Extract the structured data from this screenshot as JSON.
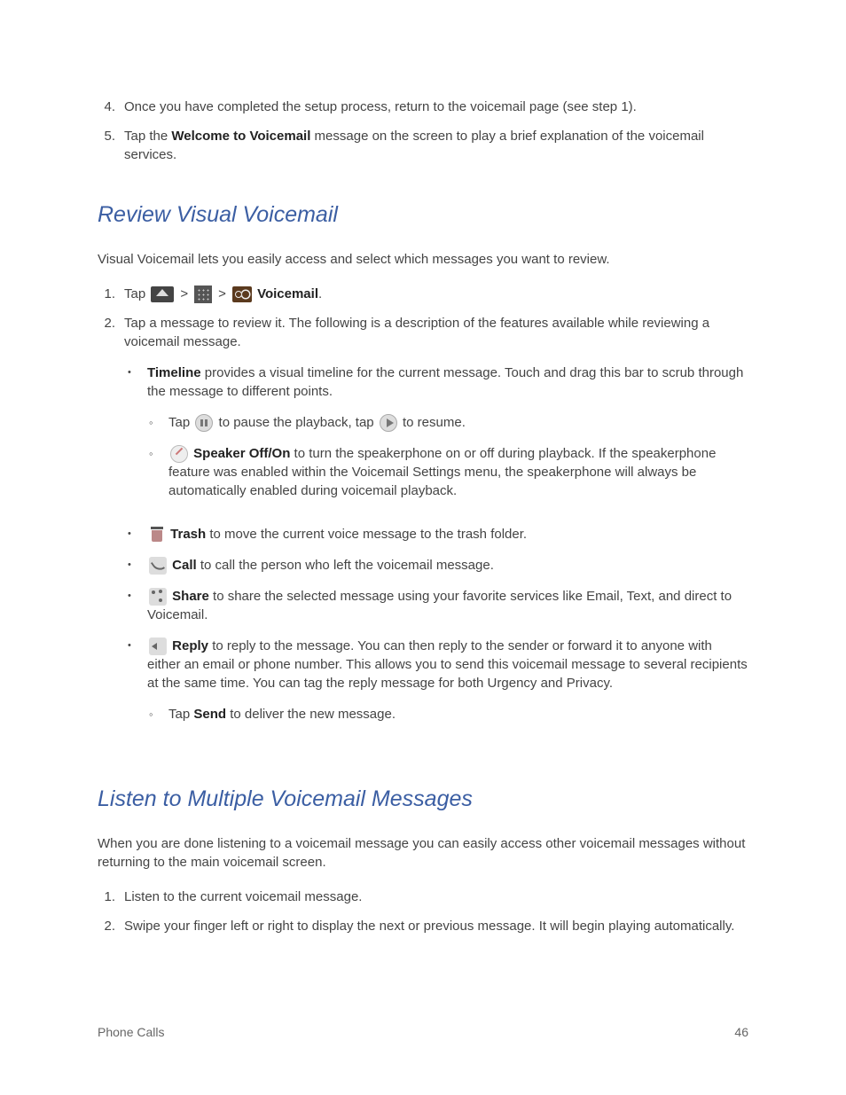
{
  "top_list": {
    "item4": {
      "num": "4.",
      "text": "Once you have completed the setup process, return to the voicemail page (see step 1)."
    },
    "item5": {
      "num": "5.",
      "pre": "Tap the ",
      "bold": "Welcome to Voicemail",
      "post": " message on the screen to play a brief explanation of the voicemail services."
    }
  },
  "section1": {
    "heading": "Review Visual Voicemail",
    "intro": "Visual Voicemail lets you easily access and select which messages you want to review.",
    "step1": {
      "num": "1.",
      "pre": "Tap ",
      "sep": ">",
      "vm_label": "Voicemail",
      "period": "."
    },
    "step2": {
      "num": "2.",
      "text": "Tap a message to review it. The following is a description of the features available while reviewing a voicemail message.",
      "timeline": {
        "bold": "Timeline",
        "text": " provides a visual timeline for the current message. Touch and drag this bar to scrub through the message to different points.",
        "sub1": {
          "pre": "Tap ",
          "mid": " to pause the playback, tap ",
          "post": " to resume."
        },
        "sub2": {
          "bold": "Speaker Off/On",
          "text": " to turn the speakerphone on or off during playback. If the speakerphone feature was enabled within the Voicemail Settings menu, the speakerphone will always be automatically enabled during voicemail playback."
        }
      },
      "trash": {
        "bold": "Trash",
        "text": " to move the current voice message to the trash folder."
      },
      "call": {
        "bold": "Call",
        "text": " to call the person who left the voicemail message."
      },
      "share": {
        "bold": "Share",
        "text": " to share the selected message using your favorite services like Email, Text, and direct to Voicemail."
      },
      "reply": {
        "bold": "Reply",
        "text": " to reply to the message. You can then reply to the sender or forward it to anyone with either an email or phone number. This allows you to send this voicemail message to several recipients at the same time. You can tag the reply message for both Urgency and Privacy.",
        "sub": {
          "pre": "Tap ",
          "bold": "Send",
          "post": " to deliver the new message."
        }
      }
    }
  },
  "section2": {
    "heading": "Listen to Multiple Voicemail Messages",
    "intro": "When you are done listening to a voicemail message you can easily access other voicemail messages without returning to the main voicemail screen.",
    "step1": {
      "num": "1.",
      "text": "Listen to the current voicemail message."
    },
    "step2": {
      "num": "2.",
      "text": "Swipe your finger left or right to display the next or previous message. It will begin playing automatically."
    }
  },
  "footer": {
    "left": "Phone Calls",
    "right": "46"
  }
}
